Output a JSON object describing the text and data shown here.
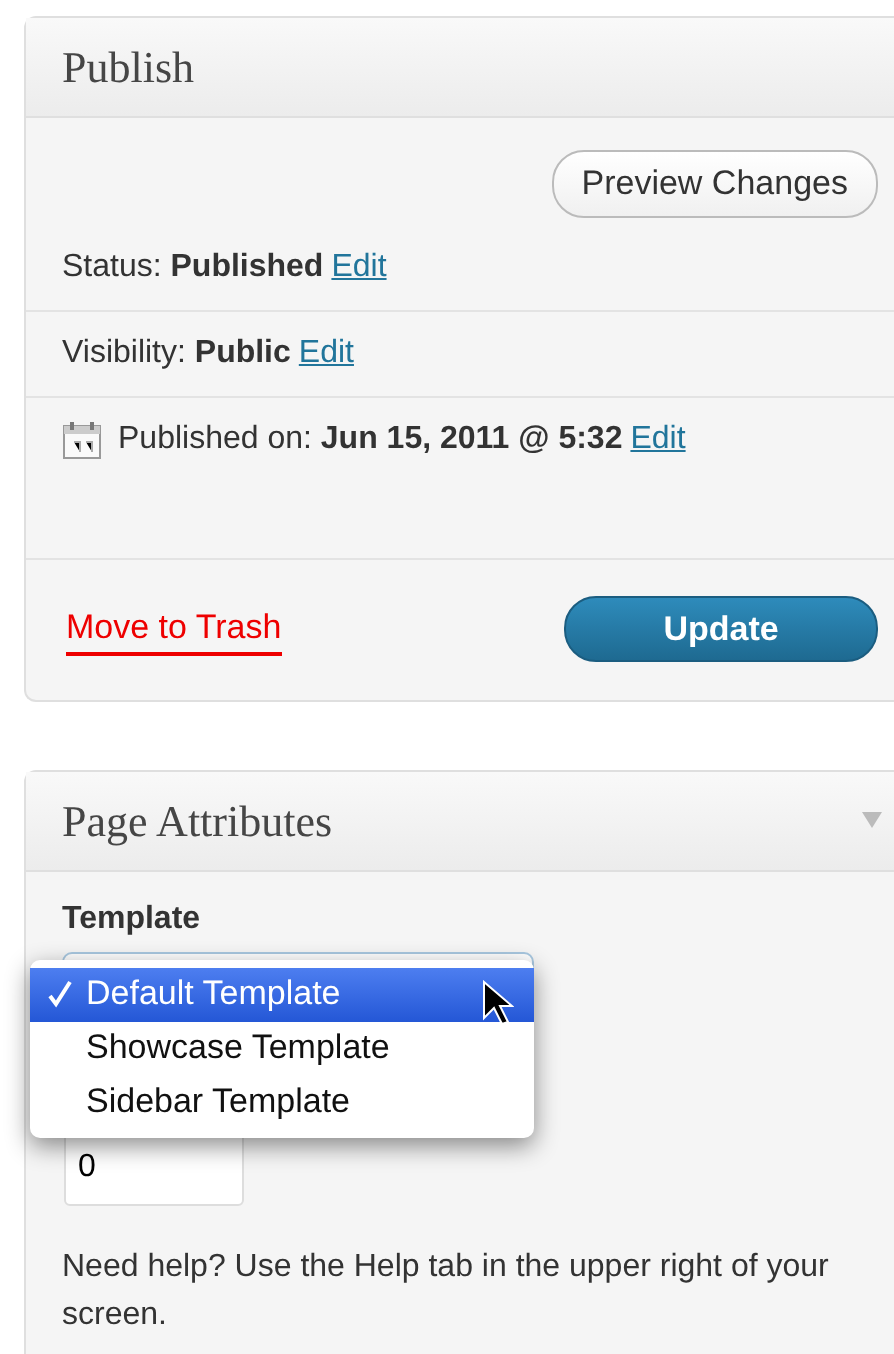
{
  "publish": {
    "title": "Publish",
    "preview_button": "Preview Changes",
    "fields": [
      {
        "label": "Status: ",
        "value": "Published",
        "link": "Edit",
        "kind": "text"
      },
      {
        "label": "Visibility: ",
        "value": "Public",
        "link": "Edit",
        "kind": "text"
      },
      {
        "label": "Published on: ",
        "value": "Jun 15, 2011 @ 5:32",
        "link": "Edit",
        "kind": "date"
      }
    ],
    "trash_link": "Move to Trash",
    "update_button": "Update"
  },
  "page_attributes": {
    "title": "Page Attributes",
    "template_label": "Template",
    "template_options": [
      {
        "label": "Default Template",
        "selected": true
      },
      {
        "label": "Showcase Template",
        "selected": false
      },
      {
        "label": "Sidebar Template",
        "selected": false
      }
    ],
    "order_value": "0",
    "help": "Need help? Use the Help tab in the upper right of your screen."
  }
}
